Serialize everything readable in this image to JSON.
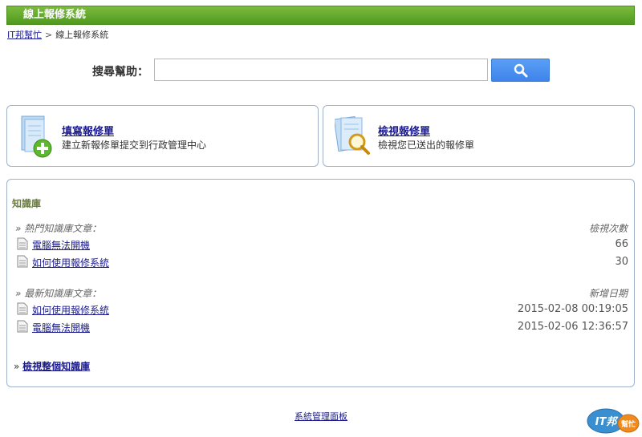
{
  "header": {
    "title": "線上報修系統"
  },
  "breadcrumb": {
    "home": "IT邦幫忙",
    "separator": ">",
    "current": "線上報修系統"
  },
  "search": {
    "label": "搜尋幫助：",
    "value": "",
    "placeholder": ""
  },
  "cards": [
    {
      "title": "填寫報修單",
      "description": "建立新報修單提交到行政管理中心"
    },
    {
      "title": "檢視報修單",
      "description": "檢視您已送出的報修單"
    }
  ],
  "knowledge_base": {
    "title": "知識庫",
    "popular": {
      "heading": "» 熱門知識庫文章：",
      "column_label": "檢視次數",
      "items": [
        {
          "title": "電腦無法開機",
          "value": "66"
        },
        {
          "title": "如何使用報修系統",
          "value": "30"
        }
      ]
    },
    "latest": {
      "heading": "» 最新知識庫文章：",
      "column_label": "新增日期",
      "items": [
        {
          "title": "如何使用報修系統",
          "value": "2015-02-08 00:19:05"
        },
        {
          "title": "電腦無法開機",
          "value": "2015-02-06 12:36:57"
        }
      ]
    },
    "view_all_prefix": "»",
    "view_all_label": "檢視整個知識庫"
  },
  "footer": {
    "admin_link": "系統管理面板"
  },
  "logo": {
    "text_main": "IT邦",
    "text_sub": "幫忙"
  },
  "colors": {
    "header_green": "#5aa427",
    "link": "#1a1a8a",
    "button_blue": "#4a8ff0",
    "card_border": "#9fb2c9"
  }
}
